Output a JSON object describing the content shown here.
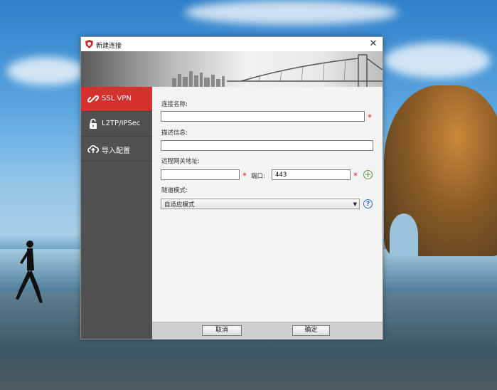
{
  "window": {
    "title": "新建连接",
    "close_icon": "close-icon",
    "app_icon": "shield-icon"
  },
  "sidebar": {
    "items": [
      {
        "label": "SSL VPN",
        "icon": "link-icon",
        "active": true
      },
      {
        "label": "L2TP/IPSec",
        "icon": "lock-icon",
        "active": false
      },
      {
        "label": "导入配置",
        "icon": "cloud-upload-icon",
        "active": false
      }
    ]
  },
  "form": {
    "name_label": "连接名称:",
    "name_value": "",
    "desc_label": "描述信息:",
    "desc_value": "",
    "gateway_label": "远程网关地址:",
    "gateway_value": "",
    "port_label": "端口:",
    "port_value": "443",
    "tunnel_label": "隧道模式:",
    "tunnel_selected": "自适应模式",
    "required_mark": "*",
    "help_mark": "?",
    "add_mark": "+"
  },
  "footer": {
    "cancel_label": "取消",
    "ok_label": "确定"
  },
  "colors": {
    "accent": "#d6312f",
    "sidebar": "#515151",
    "required": "#d62a2a",
    "help": "#2f6cc0",
    "add": "#5a9a3a"
  }
}
